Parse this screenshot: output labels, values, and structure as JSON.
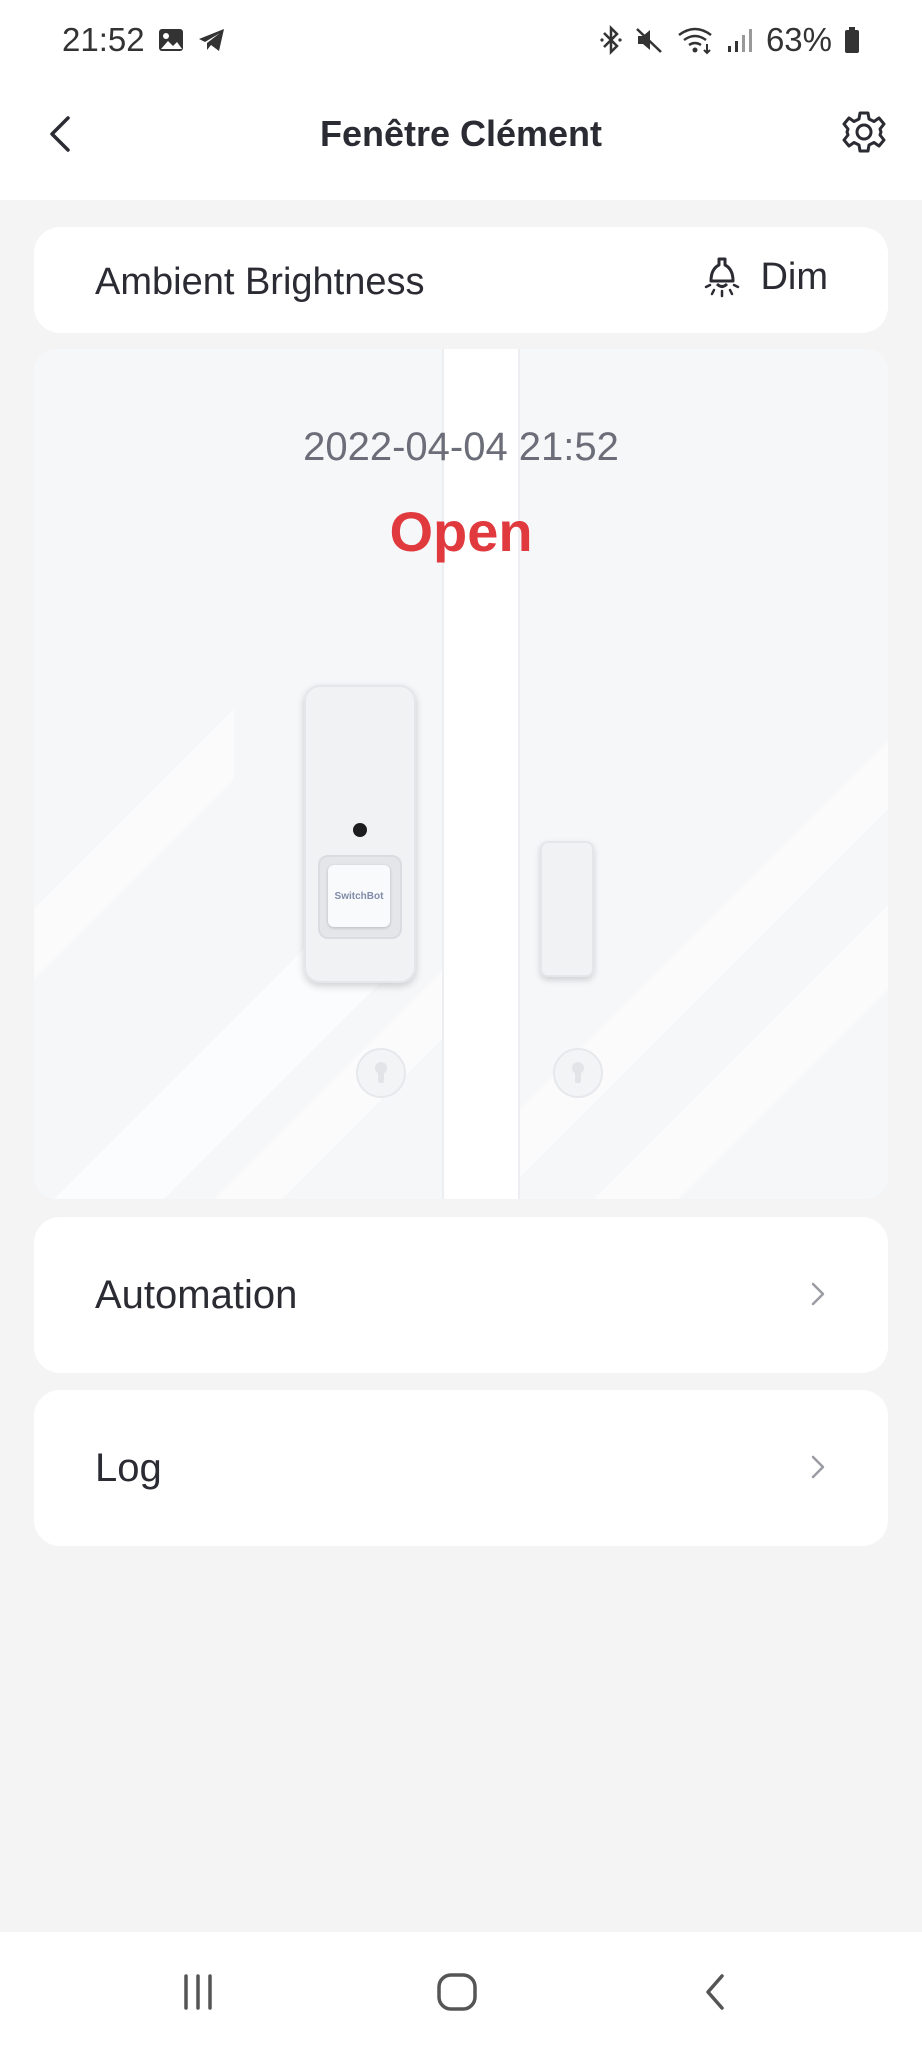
{
  "status_bar": {
    "time": "21:52",
    "battery_percent": "63%",
    "icons_left": [
      "gallery-icon",
      "telegram-icon"
    ],
    "icons_right": [
      "bluetooth-icon",
      "mute-icon",
      "wifi-icon",
      "signal-icon",
      "battery-icon"
    ]
  },
  "header": {
    "title": "Fenêtre Clément",
    "back_icon": "chevron-left-icon",
    "settings_icon": "gear-icon"
  },
  "brightness": {
    "label": "Ambient Brightness",
    "value": "Dim",
    "icon": "bulb-icon"
  },
  "sensor": {
    "timestamp": "2022-04-04 21:52",
    "state": "Open",
    "brand_label": "SwitchBot",
    "state_color": "#e0393e"
  },
  "menu": {
    "automation_label": "Automation",
    "log_label": "Log"
  },
  "nav": {
    "icons": [
      "recents-icon",
      "home-icon",
      "back-icon"
    ]
  },
  "colors": {
    "accent_red": "#e0393e",
    "background": "#f4f4f5",
    "card": "#ffffff"
  }
}
